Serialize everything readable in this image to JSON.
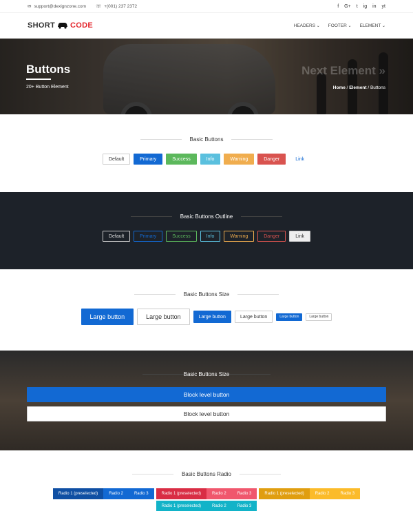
{
  "topbar": {
    "email": "support@dexignzone.com",
    "phone": "+(001) 237 2372",
    "social": [
      "f",
      "G+",
      "t",
      "ig",
      "in",
      "yt"
    ]
  },
  "nav": {
    "logo_short": "SHORT",
    "logo_code": "CODE",
    "menu": [
      "HEADERS",
      "FOOTER",
      "ELEMENT"
    ]
  },
  "hero": {
    "title": "Buttons",
    "subtitle": "20+ Button Element",
    "next": "Next Element »",
    "crumbs": [
      "Home",
      "Element",
      "Buttons"
    ]
  },
  "basic": {
    "title": "Basic Buttons",
    "buttons": [
      "Default",
      "Primary",
      "Success",
      "Info",
      "Warning",
      "Danger",
      "Link"
    ]
  },
  "outline": {
    "title": "Basic Buttons Outline",
    "buttons": [
      "Default",
      "Primary",
      "Success",
      "Info",
      "Warning",
      "Danger",
      "Link"
    ]
  },
  "sizes": {
    "title": "Basic Buttons Size",
    "buttons": [
      "Large button",
      "Large button",
      "Large button",
      "Large button",
      "Large button",
      "Large button"
    ]
  },
  "block": {
    "title": "Basic Buttons Size",
    "primary": "Block level button",
    "default": "Block level button"
  },
  "radio": {
    "title": "Basic Buttons Radio",
    "groups": [
      [
        "Radio 1 (preselected)",
        "Radio 2",
        "Radio 3"
      ],
      [
        "Radio 1 (preselected)",
        "Radio 2",
        "Radio 3"
      ],
      [
        "Radio 1 (preselected)",
        "Radio 2",
        "Radio 3"
      ],
      [
        "Radio 1 (preselected)",
        "Radio 2",
        "Radio 3"
      ]
    ]
  },
  "colors": {
    "primary": "#1269d3",
    "dark": "#1d2229",
    "accent": "#e4262c"
  }
}
